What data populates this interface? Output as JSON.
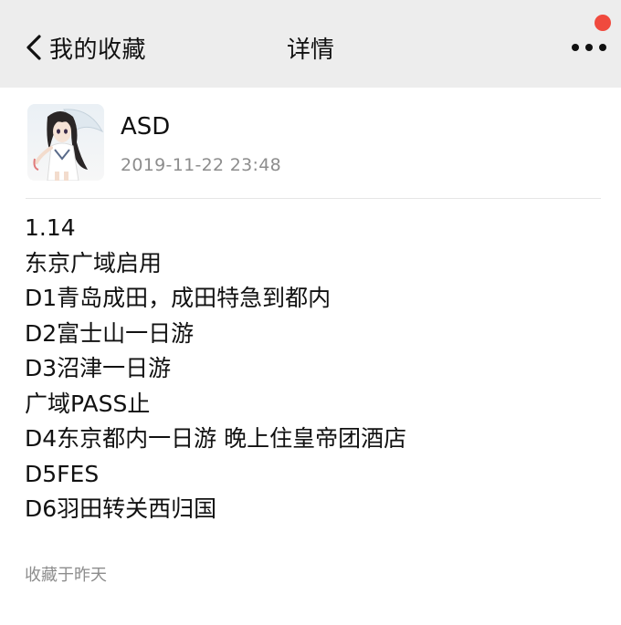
{
  "header": {
    "back_label": "我的收藏",
    "title": "详情",
    "icons": {
      "back": "chevron-left-icon",
      "more": "more-dots-icon"
    },
    "badge_color": "#f04a3e",
    "background": "#ededed"
  },
  "post": {
    "author": "ASD",
    "timestamp": "2019-11-22 23:48",
    "avatar_icon": "user-avatar",
    "lines": [
      "1.14",
      "东京广域启用",
      "D1青岛成田，成田特急到都内",
      "D2富士山一日游",
      "D3沼津一日游",
      "广域PASS止",
      "D4东京都内一日游 晚上住皇帝团酒店",
      "D5FES",
      "D6羽田转关西归国"
    ],
    "saved_label": "收藏于昨天"
  }
}
